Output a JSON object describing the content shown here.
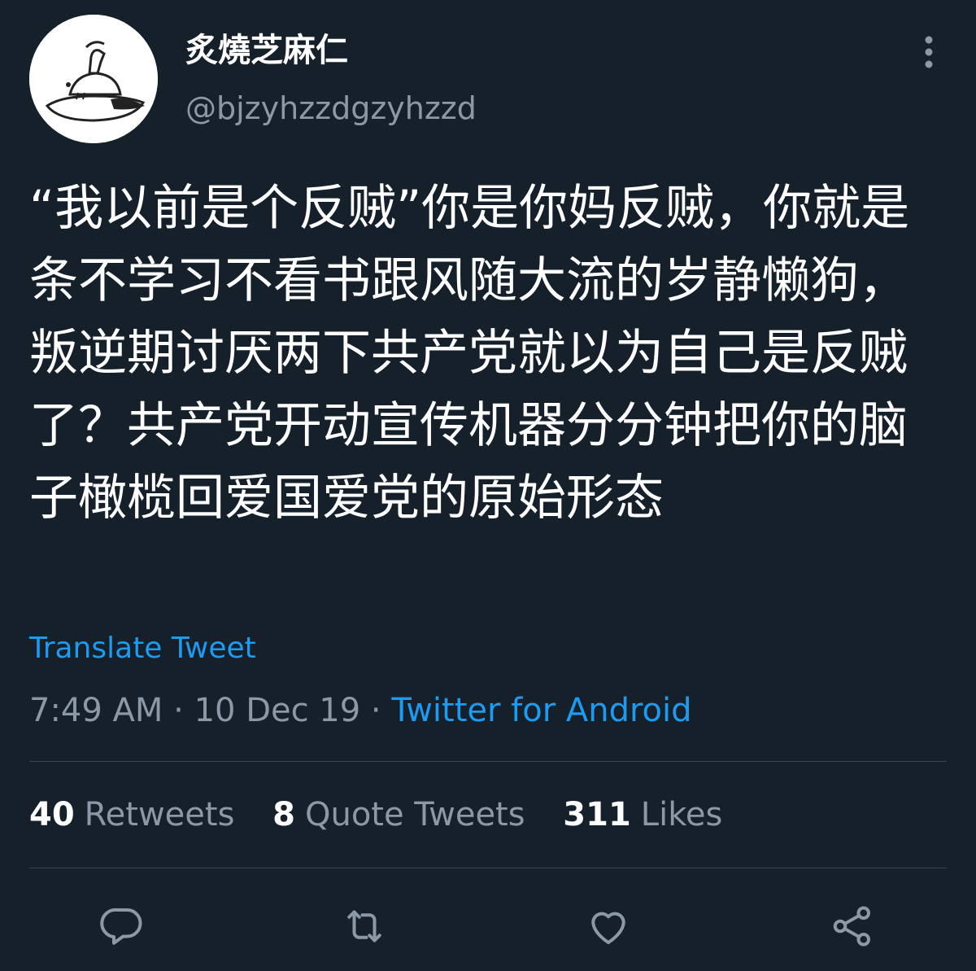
{
  "author": {
    "display_name": "炙燒芝麻仁",
    "handle": "@bjzyhzzdgzyhzzd"
  },
  "tweet": {
    "text": "“我以前是个反贼”你是你妈反贼，你就是条不学习不看书跟风随大流的岁静懒狗，叛逆期讨厌两下共产党就以为自己是反贼了？共产党开动宣传机器分分钟把你的脑子橄榄回爱国爱党的原始形态",
    "translate_label": "Translate Tweet",
    "time": "7:49 AM",
    "separator": " · ",
    "date": "10 Dec 19",
    "source": "Twitter for Android"
  },
  "stats": {
    "retweets_count": "40",
    "retweets_label": "Retweets",
    "quotes_count": "8",
    "quotes_label": "Quote Tweets",
    "likes_count": "311",
    "likes_label": "Likes"
  },
  "icons": {
    "more": "more-vertical-icon",
    "reply": "reply-icon",
    "retweet": "retweet-icon",
    "like": "heart-icon",
    "share": "share-icon"
  },
  "colors": {
    "background": "#15202b",
    "text": "#ffffff",
    "secondary": "#8b98a5",
    "accent": "#1d9bf0",
    "divider": "#38444d"
  }
}
